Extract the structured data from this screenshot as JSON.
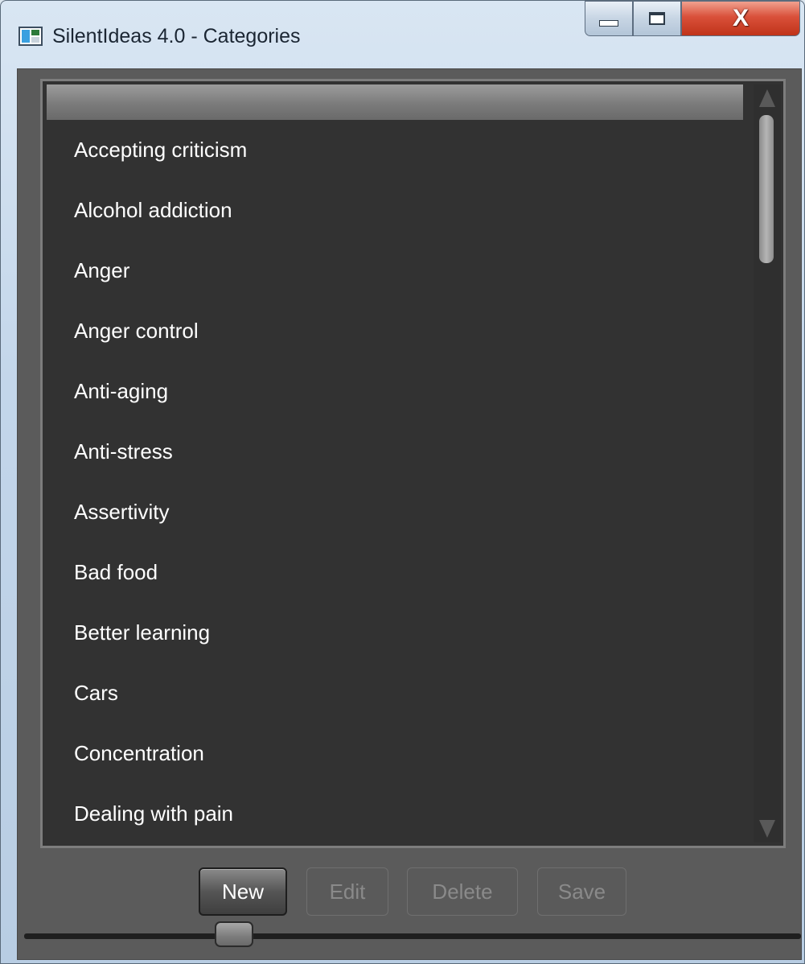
{
  "window": {
    "title": "SilentIdeas 4.0 - Categories",
    "icon": "app-window-icon",
    "controls": {
      "minimize": "minimize-icon",
      "maximize": "maximize-icon",
      "close_label": "X"
    }
  },
  "categories": {
    "items": [
      {
        "label": "Accepting criticism"
      },
      {
        "label": "Alcohol addiction"
      },
      {
        "label": "Anger"
      },
      {
        "label": "Anger control"
      },
      {
        "label": "Anti-aging"
      },
      {
        "label": "Anti-stress"
      },
      {
        "label": "Assertivity"
      },
      {
        "label": "Bad food"
      },
      {
        "label": "Better learning"
      },
      {
        "label": "Cars"
      },
      {
        "label": "Concentration"
      },
      {
        "label": "Dealing with pain"
      }
    ]
  },
  "actions": {
    "new_label": "New",
    "edit_label": "Edit",
    "delete_label": "Delete",
    "save_label": "Save"
  },
  "colors": {
    "list_background": "#323232",
    "panel_background": "#5b5b5b",
    "text": "#ffffff",
    "disabled_text": "#8a8a8a",
    "close_button": "#d9503a"
  }
}
